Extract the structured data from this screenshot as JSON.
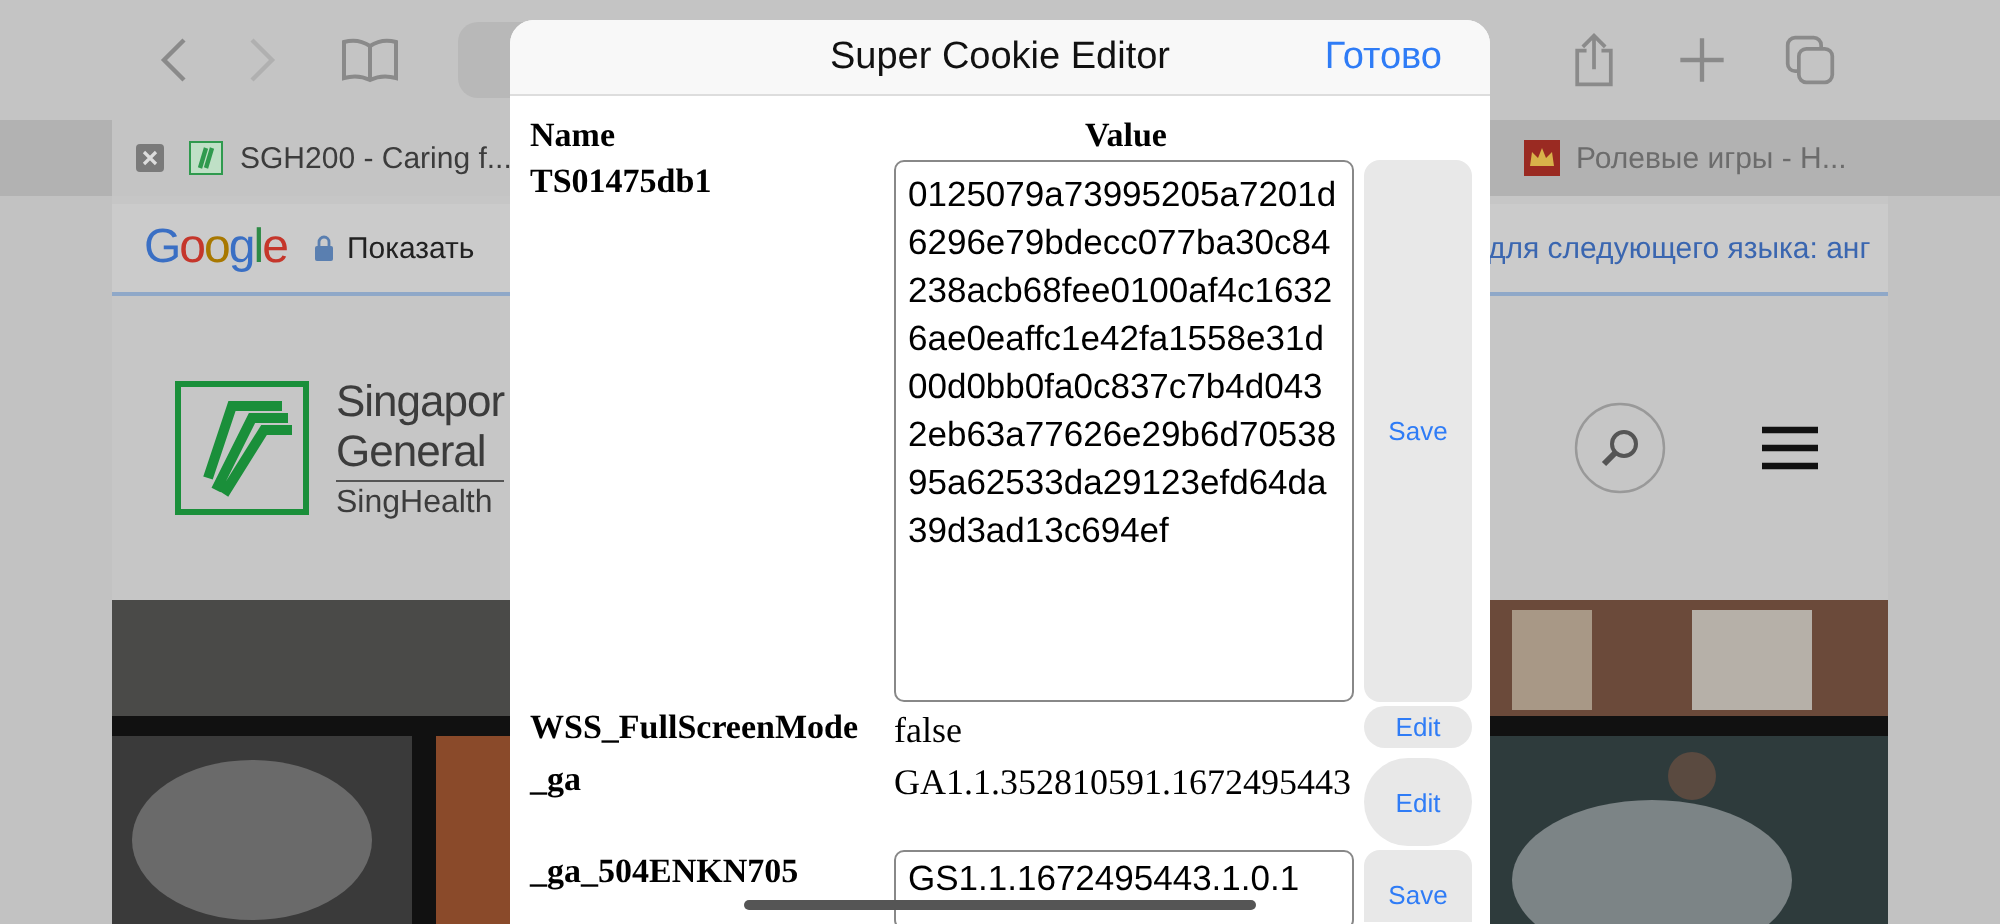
{
  "browser": {
    "back_enabled": true,
    "forward_enabled": false,
    "tabs": [
      {
        "title": "SGH200 - Caring f...",
        "selected": true
      },
      {
        "title": "Ролевые игры - Н...",
        "selected": false
      }
    ],
    "translate_bar": {
      "logo": "Google",
      "show_label": "Показать",
      "language_text": "для следующего языка: анг"
    },
    "site": {
      "logo_lines": [
        "Singapor",
        "General",
        "SingHealth"
      ]
    }
  },
  "dialog": {
    "title": "Super Cookie Editor",
    "done": "Готово",
    "columns": [
      "Name",
      "Value"
    ],
    "cookies": [
      {
        "name": "TS01475db1",
        "value": "0125079a73995205a7201d6296e79bdecc077ba30c84238acb68fee0100af4c16326ae0eaffc1e42fa1558e31d00d0bb0fa0c837c7b4d0432eb63a77626e29b6d7053895a62533da29123efd64da39d3ad13c694ef",
        "kind": "editing",
        "action": "Save"
      },
      {
        "name": "WSS_FullScreenMode",
        "value": "false",
        "kind": "text",
        "action": "Edit"
      },
      {
        "name": "_ga",
        "value": "GA1.1.352810591.1672495443",
        "kind": "text",
        "action": "Edit"
      },
      {
        "name": "_ga_504ENKN705",
        "value": "GS1.1.1672495443.1.0.1",
        "kind": "editing",
        "action": "Save"
      }
    ]
  }
}
